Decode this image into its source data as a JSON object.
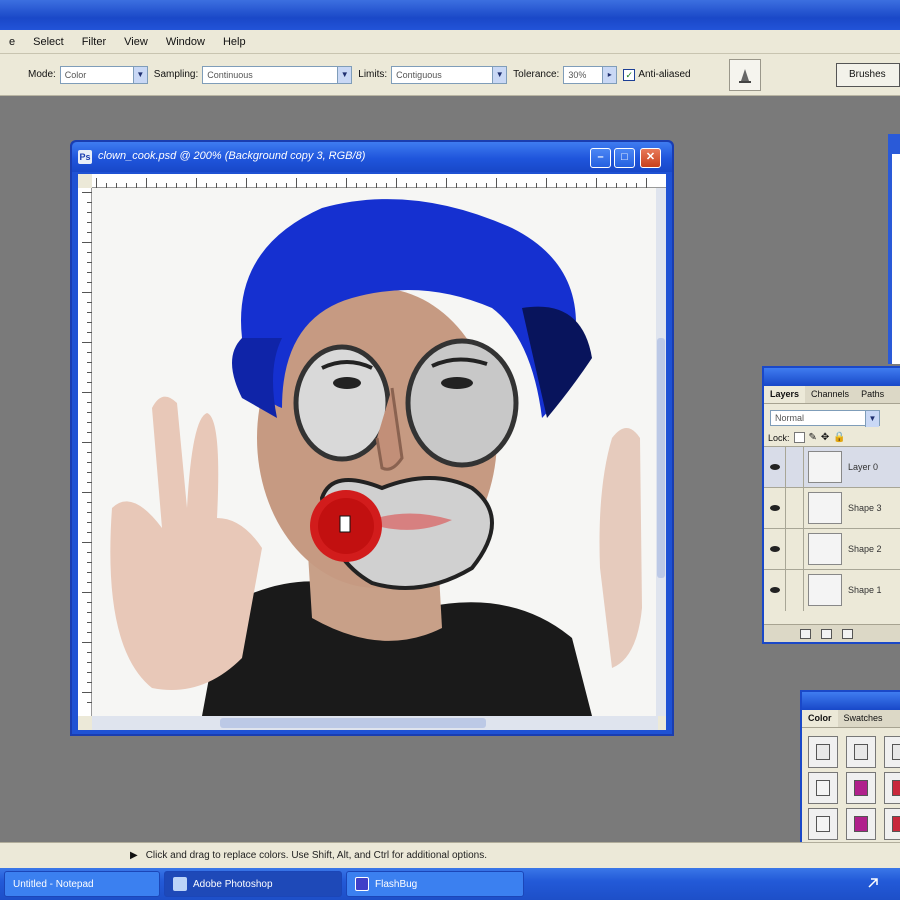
{
  "menubar": {
    "items": [
      "e",
      "Select",
      "Filter",
      "View",
      "Window",
      "Help"
    ]
  },
  "options": {
    "mode_label": "Mode:",
    "mode_value": "Color",
    "sampling_label": "Sampling:",
    "sampling_value": "Continuous",
    "limits_label": "Limits:",
    "limits_value": "Contiguous",
    "tolerance_label": "Tolerance:",
    "tolerance_value": "30%",
    "anti_alias_label": "Anti-aliased",
    "anti_alias_checked": true,
    "brushes_label": "Brushes"
  },
  "document": {
    "title": "clown_cook.psd @ 200% (Background copy 3, RGB/8)",
    "ps_badge": "Ps"
  },
  "layers_panel": {
    "tabs": [
      "Layers",
      "Channels",
      "Paths"
    ],
    "blend_mode": "Normal",
    "lock_label": "Lock:",
    "layers": [
      {
        "name": "Layer 0",
        "selected": true
      },
      {
        "name": "Shape 3",
        "selected": false
      },
      {
        "name": "Shape 2",
        "selected": false
      },
      {
        "name": "Shape 1",
        "selected": false
      }
    ]
  },
  "color_panel": {
    "tabs": [
      "Color",
      "Swatches"
    ],
    "swatch_colors": [
      "#e8e8e8",
      "#e8e8e8",
      "#e8e8e8",
      "#f4f4f4",
      "#b0208c",
      "#c8283c",
      "#f4f4f4",
      "#b0208c",
      "#c8283c"
    ]
  },
  "statusbar": {
    "text": "Click and drag to replace colors. Use Shift, Alt, and Ctrl for additional options."
  },
  "taskbar": {
    "items": [
      {
        "label": "Untitled - Notepad",
        "active": false
      },
      {
        "label": "Adobe Photoshop",
        "active": true
      },
      {
        "label": "FlashBug",
        "active": false
      }
    ]
  },
  "colors": {
    "xp_blue": "#1f52d4",
    "panel_bg": "#ece9d8",
    "workspace": "#7a7a7a"
  }
}
